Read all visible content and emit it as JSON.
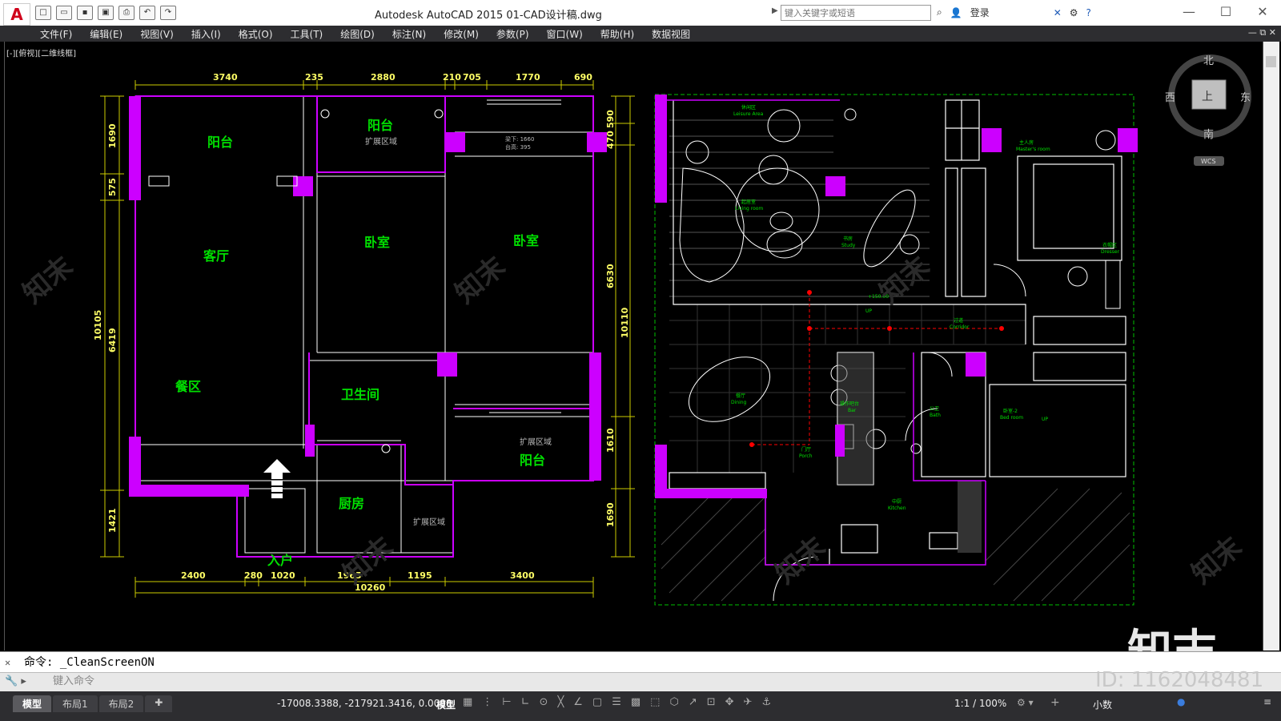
{
  "window": {
    "title": "Autodesk AutoCAD 2015    01-CAD设计稿.dwg",
    "search_placeholder": "键入关键字或短语",
    "login": "登录"
  },
  "quick_access": [
    "new",
    "open",
    "save",
    "saveas",
    "print",
    "undo",
    "redo"
  ],
  "menu": [
    "文件(F)",
    "编辑(E)",
    "视图(V)",
    "插入(I)",
    "格式(O)",
    "工具(T)",
    "绘图(D)",
    "标注(N)",
    "修改(M)",
    "参数(P)",
    "窗口(W)",
    "帮助(H)",
    "数据视图"
  ],
  "viewport_label": "[-][俯视][二维线框]",
  "viewcube": {
    "north": "北",
    "south": "南",
    "east": "东",
    "west": "西",
    "top": "上",
    "wcs": "WCS"
  },
  "plan_left": {
    "dims_top": [
      "3740",
      "235",
      "2880",
      "210",
      "705",
      "1770",
      "690"
    ],
    "dims_bottom": [
      "2400",
      "280",
      "1020",
      "1965",
      "1195",
      "3400"
    ],
    "dim_total_bottom": "10260",
    "dims_left": [
      "1690",
      "575",
      "6419",
      "1421"
    ],
    "dim_total_left": "10105",
    "dims_right": [
      "590",
      "470",
      "6630",
      "1610",
      "1690"
    ],
    "dim_total_right": "10110",
    "rooms": [
      "阳台",
      "阳台",
      "客厅",
      "卧室",
      "卧室",
      "餐区",
      "卫生间",
      "阳台",
      "厨房",
      "入户"
    ],
    "ext_labels": [
      "扩展区域",
      "扩展区域",
      "扩展区域"
    ],
    "notes": [
      "梁下: 1660",
      "台高: 395"
    ]
  },
  "plan_right": {
    "labels": [
      "休闲区",
      "Leisure Area",
      "起居室",
      "Living room",
      "书房",
      "Study",
      "主人房",
      "Master's room",
      "衣帽区",
      "Dresser",
      "过道",
      "Corridor",
      "餐厅",
      "Dining",
      "操作吧台",
      "Bar",
      "门厅",
      "Porch",
      "中厨",
      "Kitchen",
      "公卫",
      "Bath",
      "卧室-2",
      "Bed room",
      "+150.00",
      "UP",
      "UP"
    ]
  },
  "watermark": {
    "brand": "知末",
    "id": "ID: 1162048481"
  },
  "command": {
    "history": "命令: _CleanScreenON",
    "placeholder": "键入命令"
  },
  "status": {
    "tabs": [
      "模型",
      "布局1",
      "布局2"
    ],
    "coordinates": "-17008.3388, -217921.3416, 0.0000",
    "model": "模型",
    "scale": "1:1 / 100%",
    "units": "小数"
  },
  "colors": {
    "wall": "#cc00ff",
    "dim": "#ffff00",
    "room_label": "#00e000",
    "line": "#ffffff",
    "dashed": "#00ff00"
  }
}
